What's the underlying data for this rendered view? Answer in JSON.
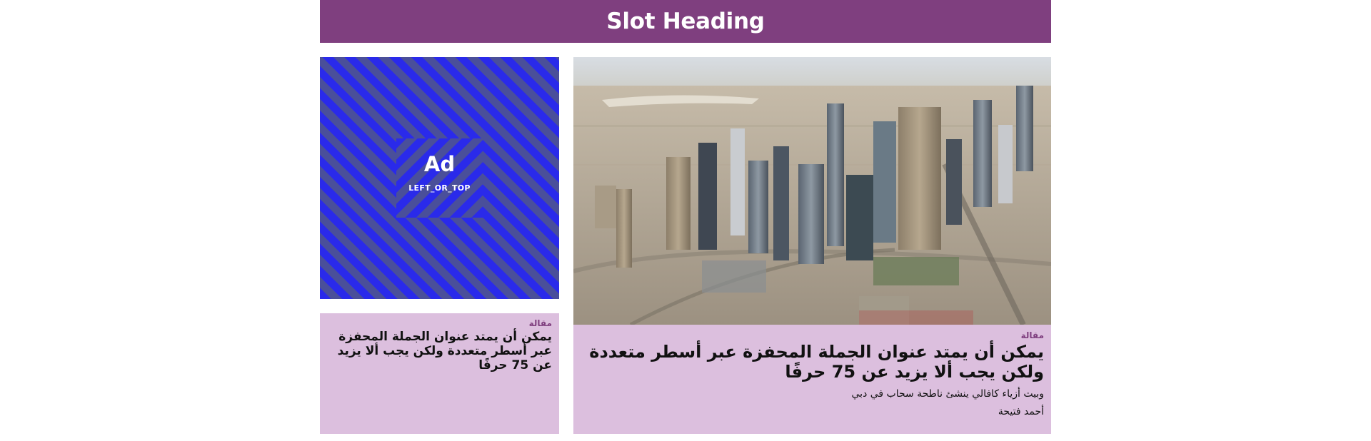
{
  "slot": {
    "heading": "Slot Heading"
  },
  "ad": {
    "title": "Ad",
    "position_label": "LEFT_OR_TOP"
  },
  "cards": {
    "main": {
      "kicker": "مقالة",
      "title": "يمكن أن يمتد عنوان الجملة المحفزة عبر أسطر متعددة ولكن يجب ألا يزيد عن 75 حرفًا",
      "subtitle": "وبيت أزياء كافالي ينشئ ناطحة سحاب في دبي",
      "author": "أحمد فتيحة"
    },
    "secondary": {
      "kicker": "مقالة",
      "title": "يمكن أن يمتد عنوان الجملة المحفزة عبر أسطر متعددة ولكن يجب ألا يزيد عن 75 حرفًا"
    }
  },
  "colors": {
    "brand_purple": "#7f3f7f",
    "card_background": "#dcbfde",
    "ad_stripe_blue": "#2a2aea",
    "ad_stripe_gray": "#4a4f9a"
  }
}
